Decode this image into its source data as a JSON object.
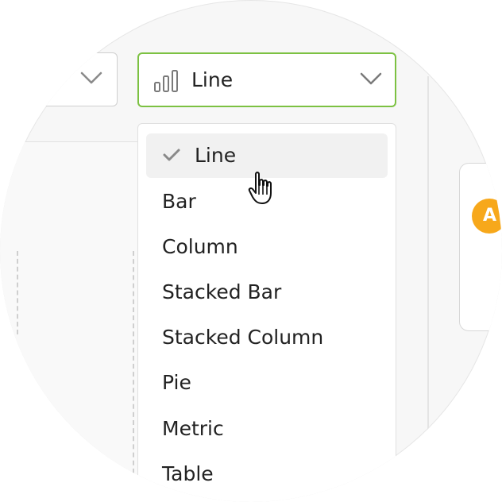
{
  "chart_type_select": {
    "value": "Line",
    "icon": "bar-chart-icon",
    "border_color": "#7cc142"
  },
  "chart_type_menu": {
    "items": [
      {
        "label": "Line",
        "selected": true
      },
      {
        "label": "Bar",
        "selected": false
      },
      {
        "label": "Column",
        "selected": false
      },
      {
        "label": "Stacked Bar",
        "selected": false
      },
      {
        "label": "Stacked Column",
        "selected": false
      },
      {
        "label": "Pie",
        "selected": false
      },
      {
        "label": "Metric",
        "selected": false
      },
      {
        "label": "Table",
        "selected": false
      }
    ]
  },
  "badge": {
    "text": "A",
    "color": "#f7a81b"
  }
}
